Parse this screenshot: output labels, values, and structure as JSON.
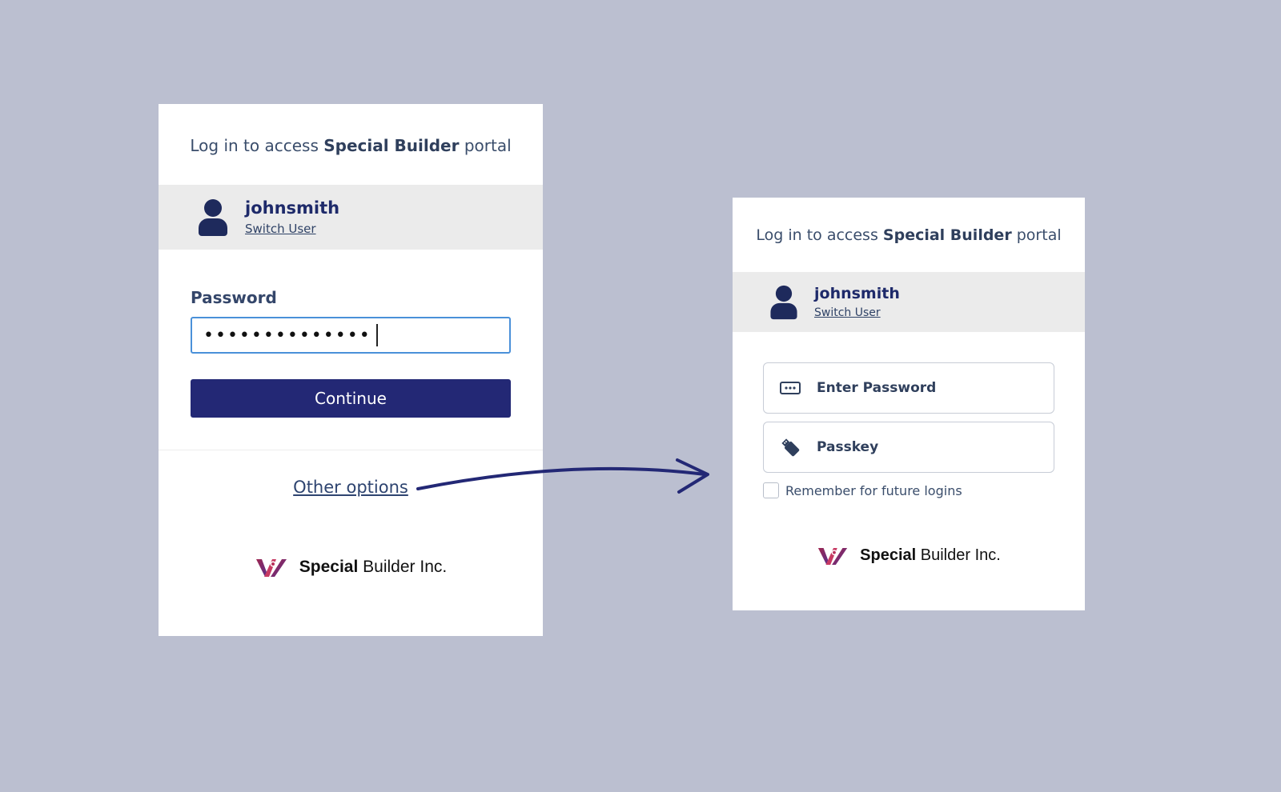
{
  "left_card": {
    "header": {
      "prefix": "Log in to access",
      "brand": "Special Builder",
      "suffix": "portal"
    },
    "user": {
      "name": "johnsmith",
      "switch_label": "Switch User"
    },
    "password": {
      "label": "Password",
      "masked_value": "••••••••••••••"
    },
    "continue_label": "Continue",
    "other_options_label": "Other options",
    "footer": {
      "brand_bold": "Special",
      "brand_rest": " Builder Inc."
    }
  },
  "right_card": {
    "header": {
      "prefix": "Log in to access",
      "brand": "Special Builder",
      "suffix": "portal"
    },
    "user": {
      "name": "johnsmith",
      "switch_label": "Switch User"
    },
    "options": [
      {
        "label": "Enter Password",
        "icon": "password-dots-icon"
      },
      {
        "label": "Passkey",
        "icon": "usb-key-icon"
      }
    ],
    "remember": {
      "label": "Remember for future logins",
      "checked": false
    },
    "footer": {
      "brand_bold": "Special",
      "brand_rest": " Builder Inc."
    }
  },
  "colors": {
    "background": "#bbbfd0",
    "primary_button": "#232875",
    "focus_border": "#4a90d9",
    "username": "#1e2a6a",
    "logo_gradient_start": "#a0264f",
    "logo_gradient_end": "#5a2f8a"
  }
}
